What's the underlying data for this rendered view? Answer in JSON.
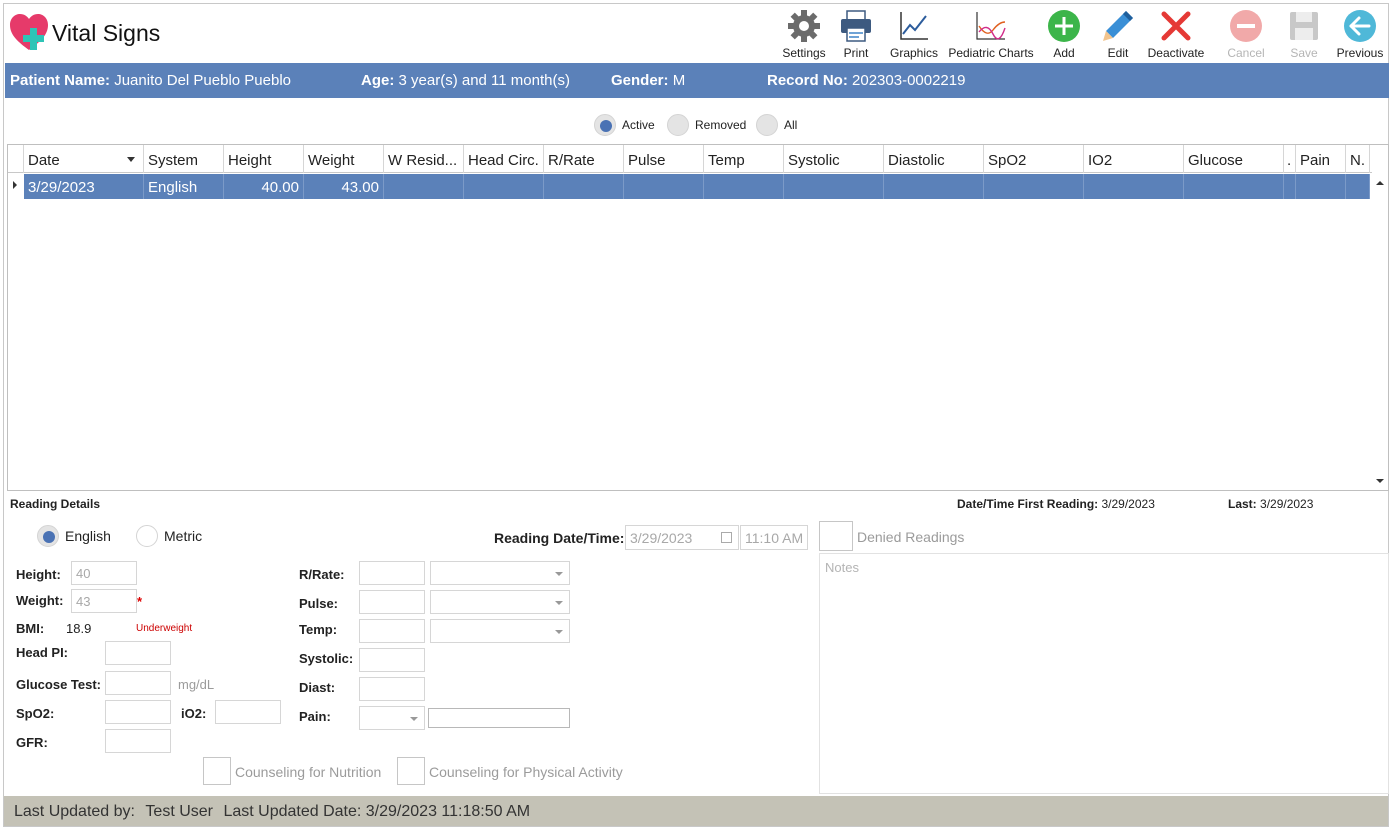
{
  "app": {
    "title": "Vital Signs"
  },
  "toolbar": {
    "settings": "Settings",
    "print": "Print",
    "graphics": "Graphics",
    "pediatric_charts": "Pediatric Charts",
    "add": "Add",
    "edit": "Edit",
    "deactivate": "Deactivate",
    "cancel": "Cancel",
    "save": "Save",
    "previous": "Previous"
  },
  "patient": {
    "name_label": "Patient Name:",
    "name": "Juanito Del Pueblo Pueblo",
    "age_label": "Age:",
    "age": "3 year(s) and 11 month(s)",
    "gender_label": "Gender:",
    "gender": "M",
    "record_label": "Record No:",
    "record": "202303-0002219"
  },
  "filter": {
    "active": "Active",
    "removed": "Removed",
    "all": "All",
    "selected": "Active"
  },
  "grid": {
    "columns": [
      "Date",
      "System",
      "Height",
      "Weight",
      "W Resid...",
      "Head Circ.",
      "R/Rate",
      "Pulse",
      "Temp",
      "Systolic",
      "Diastolic",
      "SpO2",
      "IO2",
      "Glucose",
      ".",
      "Pain",
      "N."
    ],
    "rows": [
      {
        "date": "3/29/2023",
        "system": "English",
        "height": "40.00",
        "weight": "43.00"
      }
    ]
  },
  "details": {
    "title": "Reading Details",
    "first_reading_label": "Date/Time First Reading:",
    "first_reading": "3/29/2023",
    "last_label": "Last:",
    "last": "3/29/2023",
    "unit_english": "English",
    "unit_metric": "Metric",
    "unit_selected": "English",
    "reading_datetime_label": "Reading Date/Time:",
    "reading_date": "3/29/2023",
    "reading_time": "11:10 AM",
    "denied_readings": "Denied Readings",
    "notes_placeholder": "Notes",
    "height_label": "Height:",
    "height": "40",
    "weight_label": "Weight:",
    "weight": "43",
    "required_mark": "*",
    "bmi_label": "BMI:",
    "bmi": "18.9",
    "bmi_status": "Underweight",
    "head_label": "Head PI:",
    "glucose_label": "Glucose Test:",
    "glucose_unit": "mg/dL",
    "spo2_label": "SpO2:",
    "io2_label": "iO2:",
    "gfr_label": "GFR:",
    "rrate_label": "R/Rate:",
    "pulse_label": "Pulse:",
    "temp_label": "Temp:",
    "systolic_label": "Systolic:",
    "diast_label": "Diast:",
    "pain_label": "Pain:",
    "counseling_nutrition": "Counseling for Nutrition",
    "counseling_activity": "Counseling for Physical Activity"
  },
  "status": {
    "updated_by_label": "Last Updated by:",
    "updated_by": "Test User",
    "updated_date_label": "Last Updated Date:",
    "updated_date": "3/29/2023 11:18:50 AM"
  },
  "colors": {
    "accent": "#5b81b9",
    "status_bar": "#c4c2b6",
    "add": "#3cb54a",
    "deactivate": "#e53935",
    "previous": "#4fb8d8"
  },
  "icons": [
    "heart-plus-logo-icon",
    "gear-icon",
    "printer-icon",
    "line-chart-icon",
    "pediatric-chart-icon",
    "plus-circle-icon",
    "pencil-icon",
    "x-icon",
    "minus-circle-icon",
    "floppy-icon",
    "arrow-left-circle-icon"
  ]
}
